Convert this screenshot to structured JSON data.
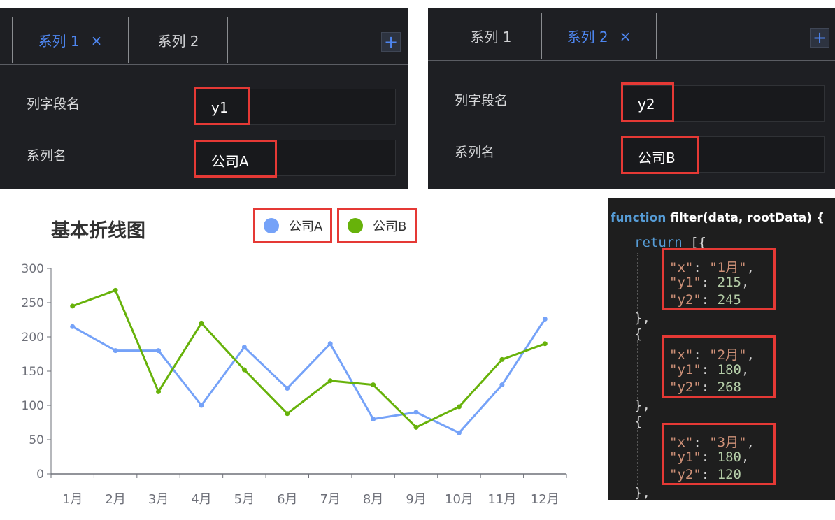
{
  "left_panel": {
    "tabs": [
      {
        "label": "系列 1",
        "active": true,
        "close": "×"
      },
      {
        "label": "系列 2",
        "active": false
      }
    ],
    "add_label": "+",
    "fields": [
      {
        "label": "列字段名",
        "value": "y1"
      },
      {
        "label": "系列名",
        "value": "公司A"
      }
    ]
  },
  "right_panel": {
    "tabs": [
      {
        "label": "系列 1",
        "active": false
      },
      {
        "label": "系列 2",
        "active": true,
        "close": "×"
      }
    ],
    "add_label": "+",
    "fields": [
      {
        "label": "列字段名",
        "value": "y2"
      },
      {
        "label": "系列名",
        "value": "公司B"
      }
    ]
  },
  "chart_data": {
    "type": "line",
    "title": "基本折线图",
    "categories": [
      "1月",
      "2月",
      "3月",
      "4月",
      "5月",
      "6月",
      "7月",
      "8月",
      "9月",
      "10月",
      "11月",
      "12月"
    ],
    "series": [
      {
        "name": "公司A",
        "color": "#75a2f8",
        "values": [
          215,
          180,
          180,
          100,
          185,
          125,
          190,
          80,
          90,
          60,
          130,
          226
        ]
      },
      {
        "name": "公司B",
        "color": "#67b20a",
        "values": [
          245,
          268,
          120,
          220,
          152,
          88,
          136,
          130,
          68,
          98,
          167,
          190
        ]
      }
    ],
    "ylim": [
      0,
      300
    ],
    "yticks": [
      "0",
      "50",
      "100",
      "150",
      "200",
      "250",
      "300"
    ],
    "grid": false,
    "legend": "top"
  },
  "code": {
    "header_kw": "function",
    "header_rest": " filter(data, rootData) {",
    "return_kw": "return",
    "return_rest": " [{",
    "records": [
      {
        "x": "1月",
        "y1": "215",
        "y2": "245"
      },
      {
        "x": "2月",
        "y1": "180",
        "y2": "268"
      },
      {
        "x": "3月",
        "y1": "180",
        "y2": "120"
      }
    ]
  }
}
